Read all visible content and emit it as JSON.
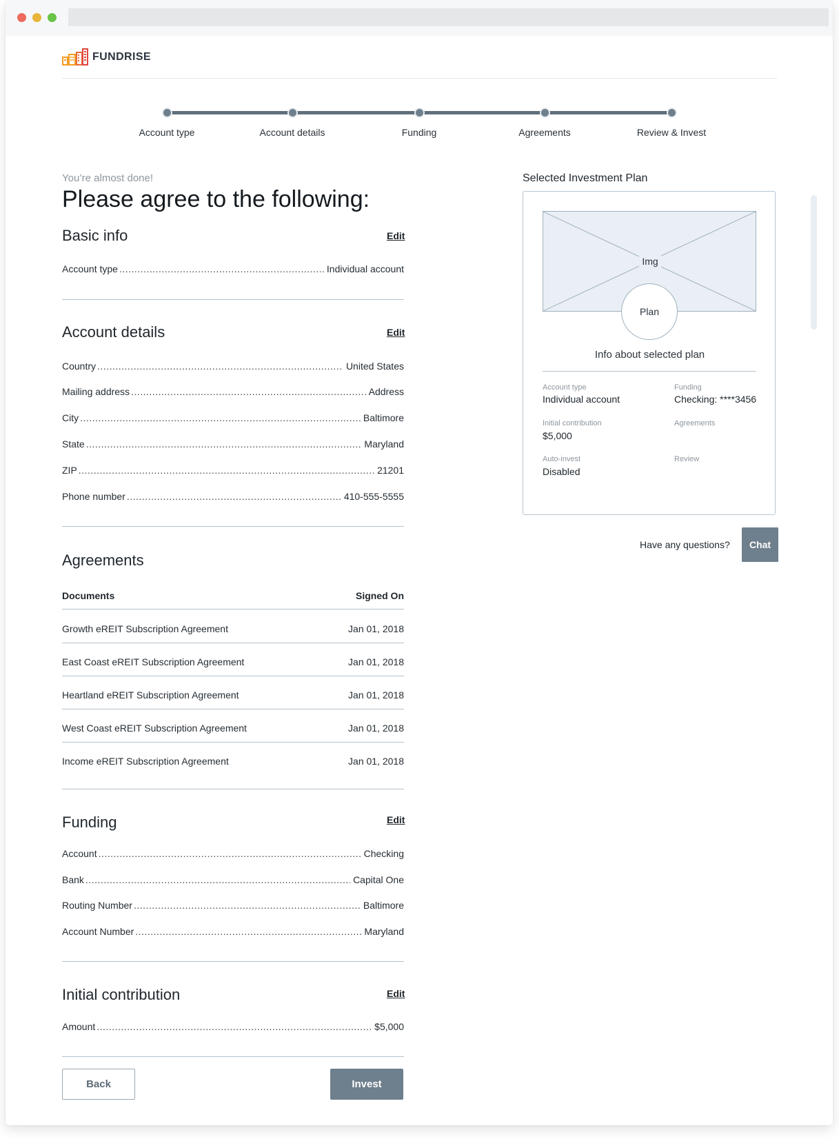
{
  "brand": {
    "name": "FUNDRISE"
  },
  "steps": [
    {
      "label": "Account type"
    },
    {
      "label": "Account details"
    },
    {
      "label": "Funding"
    },
    {
      "label": "Agreements"
    },
    {
      "label": "Review & Invest"
    }
  ],
  "intro": {
    "eyebrow": "You’re almost done!",
    "title": "Please agree to the following:"
  },
  "basic_info": {
    "title": "Basic info",
    "edit": "Edit",
    "rows": [
      {
        "label": "Account type",
        "value": "Individual account"
      }
    ]
  },
  "account_details": {
    "title": "Account details",
    "edit": "Edit",
    "rows": [
      {
        "label": "Country",
        "value": "United States"
      },
      {
        "label": "Mailing address",
        "value": "Address"
      },
      {
        "label": "City",
        "value": "Baltimore"
      },
      {
        "label": "State",
        "value": "Maryland"
      },
      {
        "label": "ZIP",
        "value": "21201"
      },
      {
        "label": "Phone number",
        "value": "410-555-5555"
      }
    ]
  },
  "agreements": {
    "title": "Agreements",
    "columns": {
      "documents": "Documents",
      "signed_on": "Signed On"
    },
    "rows": [
      {
        "document": "Growth eREIT Subscription Agreement",
        "signed_on": "Jan 01, 2018"
      },
      {
        "document": "East Coast eREIT Subscription Agreement",
        "signed_on": "Jan 01, 2018"
      },
      {
        "document": "Heartland eREIT Subscription Agreement",
        "signed_on": "Jan 01, 2018"
      },
      {
        "document": "West Coast eREIT Subscription Agreement",
        "signed_on": "Jan 01, 2018"
      },
      {
        "document": "Income eREIT Subscription Agreement",
        "signed_on": "Jan 01, 2018"
      }
    ]
  },
  "funding": {
    "title": "Funding",
    "edit": "Edit",
    "rows": [
      {
        "label": "Account",
        "value": "Checking"
      },
      {
        "label": "Bank",
        "value": "Capital One"
      },
      {
        "label": "Routing Number",
        "value": "Baltimore"
      },
      {
        "label": "Account Number",
        "value": "Maryland"
      }
    ]
  },
  "initial_contribution": {
    "title": "Initial contribution",
    "edit": "Edit",
    "rows": [
      {
        "label": "Amount",
        "value": "$5,000"
      }
    ]
  },
  "buttons": {
    "back": "Back",
    "invest": "Invest",
    "chat": "Chat"
  },
  "plan": {
    "heading": "Selected Investment Plan",
    "img_label": "Img",
    "circle_label": "Plan",
    "info": "Info about selected plan",
    "fields": {
      "account_type": {
        "label": "Account type",
        "value": "Individual account"
      },
      "funding": {
        "label": "Funding",
        "value": "Checking: ****3456"
      },
      "initial_contribution": {
        "label": "Initial contribution",
        "value": "$5,000"
      },
      "agreements": {
        "label": "Agreements"
      },
      "auto_invest": {
        "label": "Auto-invest",
        "value": "Disabled"
      },
      "review": {
        "label": "Review"
      }
    }
  },
  "help": {
    "question": "Have any questions?"
  },
  "colors": {
    "primary_button": "#6e7f8d",
    "stepper": "#5f6f7d",
    "divider": "#b5c2cc",
    "logo_orange": "#f39c1f",
    "logo_red": "#e2453c"
  }
}
